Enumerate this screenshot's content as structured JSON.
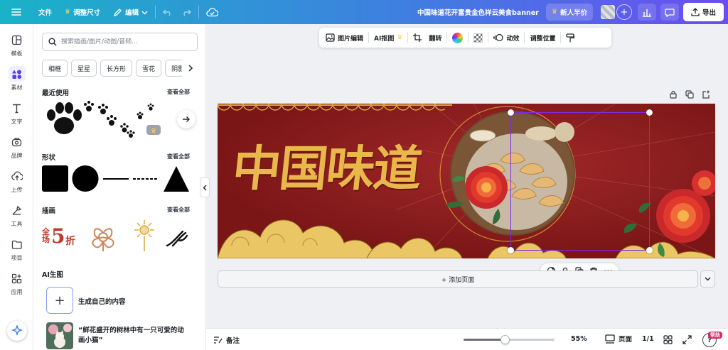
{
  "topbar": {
    "file": "文件",
    "resize": "调整尺寸",
    "edit": "编辑",
    "doc_title": "中国味道花开富贵金色祥云美食banner",
    "promo": "新人半价",
    "export": "导出"
  },
  "rail": {
    "items": [
      {
        "label": "模板",
        "icon": "template-icon"
      },
      {
        "label": "素材",
        "icon": "elements-icon"
      },
      {
        "label": "文字",
        "icon": "text-icon"
      },
      {
        "label": "品牌",
        "icon": "brand-icon"
      },
      {
        "label": "上传",
        "icon": "upload-icon"
      },
      {
        "label": "工具",
        "icon": "tools-icon"
      },
      {
        "label": "项目",
        "icon": "folder-icon"
      },
      {
        "label": "应用",
        "icon": "apps-icon"
      }
    ]
  },
  "panel": {
    "search_placeholder": "搜索插画/图片/动图/音频...",
    "chips": [
      "相框",
      "星星",
      "长方形",
      "雪花",
      "阴影"
    ],
    "recent": {
      "title": "最近使用",
      "more": "查看全部"
    },
    "shapes": {
      "title": "形状",
      "more": "查看全部"
    },
    "illustrations": {
      "title": "插画",
      "more": "查看全部"
    },
    "ai": {
      "title": "AI生图",
      "generate": "生成自己的内容",
      "prompt_line1": "“鲜花盛开的树林中有一只可爱的动",
      "prompt_line2": "画小猫”"
    }
  },
  "context_toolbar": {
    "image_edit": "图片编辑",
    "ai_cutout": "AI抠图",
    "flip": "翻转",
    "animate": "动效",
    "position": "调整位置"
  },
  "banner": {
    "headline": "中国味道",
    "sale_text_top": "全场",
    "sale_number": "5",
    "sale_suffix": "折"
  },
  "canvas": {
    "add_page": "+ 添加页面"
  },
  "bottombar": {
    "notes": "备注",
    "zoom": "55%",
    "zoom_fraction": 0.45,
    "pages": "页面",
    "page_count": "1/1",
    "help": "帮助"
  },
  "colors": {
    "accent": "#7d2ae8",
    "banner_red": "#8a1c1c",
    "gold": "#d9a83a"
  }
}
